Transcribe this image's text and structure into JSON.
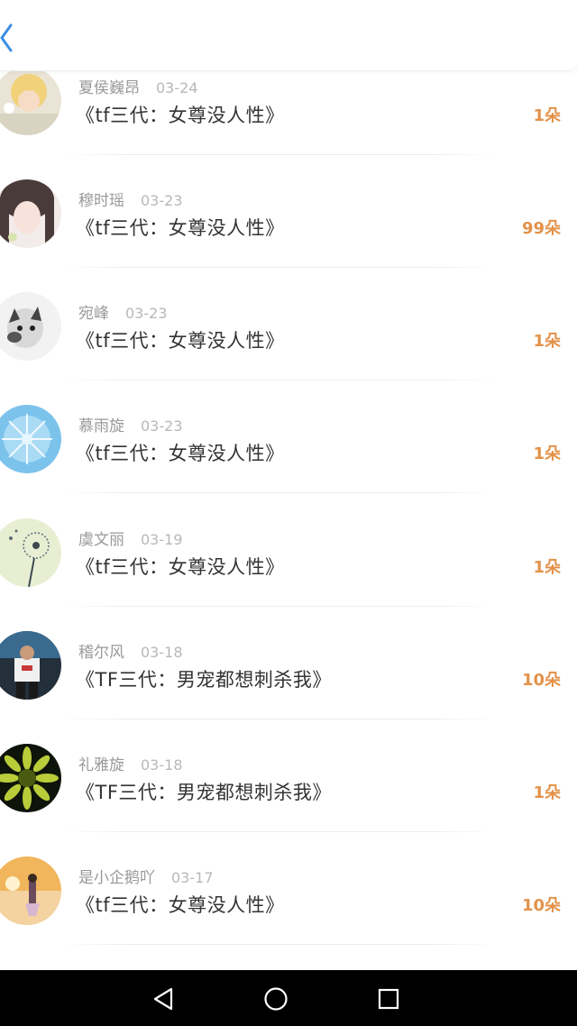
{
  "header": {
    "back_icon": "chevron-left-icon"
  },
  "colors": {
    "accent": "#3a8ee6",
    "count": "#e3924a",
    "name": "#999999",
    "title": "#333333",
    "navbar": "#000000"
  },
  "gifts": [
    {
      "name": "夏侯巍昂",
      "date": "03-24",
      "title": "《tf三代：女尊没人性》",
      "count": "1朵"
    },
    {
      "name": "穆时瑶",
      "date": "03-23",
      "title": "《tf三代：女尊没人性》",
      "count": "99朵"
    },
    {
      "name": "宛峰",
      "date": "03-23",
      "title": "《tf三代：女尊没人性》",
      "count": "1朵"
    },
    {
      "name": "慕雨旋",
      "date": "03-23",
      "title": "《tf三代：女尊没人性》",
      "count": "1朵"
    },
    {
      "name": "虞文丽",
      "date": "03-19",
      "title": "《tf三代：女尊没人性》",
      "count": "1朵"
    },
    {
      "name": "稽尔风",
      "date": "03-18",
      "title": "《TF三代：男宠都想刺杀我》",
      "count": "10朵"
    },
    {
      "name": "礼雅旋",
      "date": "03-18",
      "title": "《TF三代：男宠都想刺杀我》",
      "count": "1朵"
    },
    {
      "name": "是小企鹅吖",
      "date": "03-17",
      "title": "《tf三代：女尊没人性》",
      "count": "10朵"
    }
  ],
  "navbar": {
    "back_icon": "triangle-back-icon",
    "home_icon": "circle-home-icon",
    "recents_icon": "square-recents-icon"
  }
}
